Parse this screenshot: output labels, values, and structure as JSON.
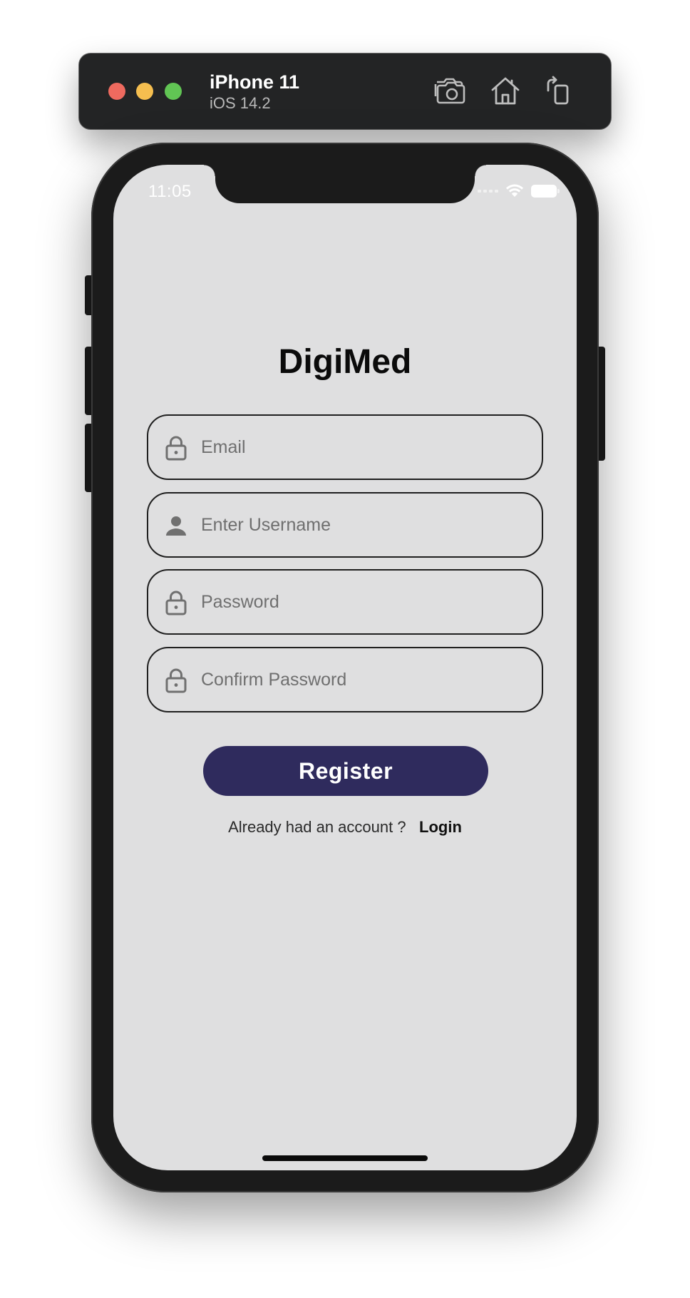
{
  "simulator": {
    "device_name": "iPhone 11",
    "os_version": "iOS 14.2",
    "toolbar_icons": [
      "screenshot-icon",
      "home-icon",
      "rotate-icon"
    ]
  },
  "status_bar": {
    "time": "11:05",
    "icons": [
      "signal-icon",
      "wifi-icon",
      "battery-icon"
    ]
  },
  "app": {
    "title": "DigiMed",
    "fields": [
      {
        "icon": "lock-icon",
        "placeholder": "Email",
        "value": ""
      },
      {
        "icon": "person-icon",
        "placeholder": "Enter Username",
        "value": ""
      },
      {
        "icon": "lock-icon",
        "placeholder": "Password",
        "value": ""
      },
      {
        "icon": "lock-icon",
        "placeholder": "Confirm Password",
        "value": ""
      }
    ],
    "register_label": "Register",
    "login_prompt": "Already had an account ?",
    "login_label": "Login"
  },
  "colors": {
    "screen_background": "#dfdfe0",
    "primary_button": "#2f2b5d",
    "field_border": "#1f1f1f",
    "icon_gray": "#707070"
  }
}
